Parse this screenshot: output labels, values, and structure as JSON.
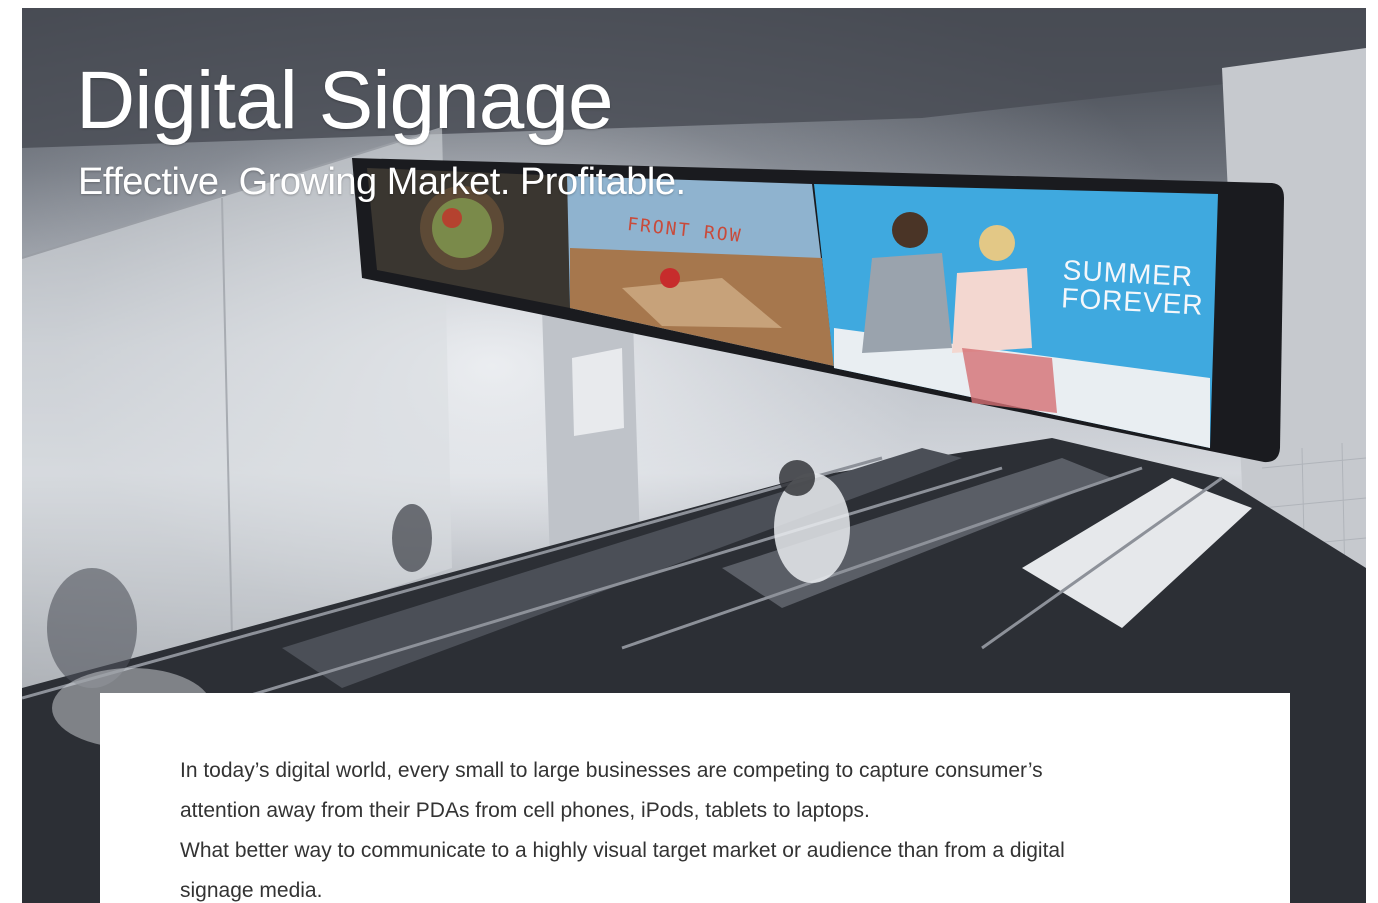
{
  "hero": {
    "title": "Digital Signage",
    "subtitle": "Effective. Growing Market. Profitable.",
    "ad_panels": [
      {
        "name": "food",
        "text": ""
      },
      {
        "name": "front-row",
        "text": "FRONT ROW"
      },
      {
        "name": "summer-forever",
        "text_line1": "SUMMER",
        "text_line2": "FOREVER"
      }
    ]
  },
  "body": {
    "line1": "In today’s digital world, every small to large businesses are competing to capture consumer’s",
    "line2": "attention away from their PDAs from cell phones, iPods, tablets to laptops.",
    "line3": "What better way to communicate to a highly visual target market or audience than from a digital",
    "line4": "signage media."
  },
  "colors": {
    "title": "#ffffff",
    "body_text": "#333333",
    "ad_blue": "#3fa9df",
    "front_row_red": "#c94a3a"
  }
}
